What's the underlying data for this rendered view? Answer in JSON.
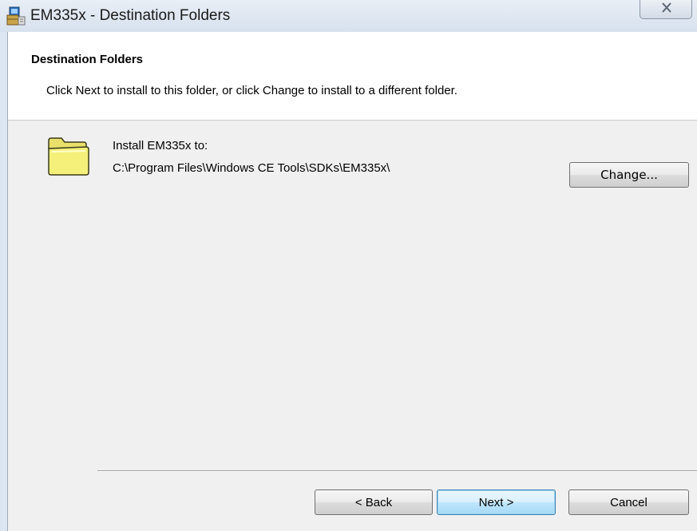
{
  "window": {
    "title": "EM335x - Destination Folders",
    "icons": {
      "app": "installer-package-icon",
      "close": "close-icon"
    }
  },
  "banner": {
    "title": "Destination Folders",
    "description": "Click Next to install to this folder, or click Change to install to a different folder."
  },
  "install": {
    "folder_icon": "folder-icon",
    "label": "Install EM335x to:",
    "path": "C:\\Program Files\\Windows CE Tools\\SDKs\\EM335x\\",
    "change_label": "Change..."
  },
  "footer": {
    "back_label": "< Back",
    "next_label": "Next >",
    "cancel_label": "Cancel"
  },
  "colors": {
    "client_bg": "#f0f0f0",
    "banner_bg": "#ffffff",
    "default_button_border": "#3c7fb1",
    "folder_fill": "#f5f07a"
  }
}
